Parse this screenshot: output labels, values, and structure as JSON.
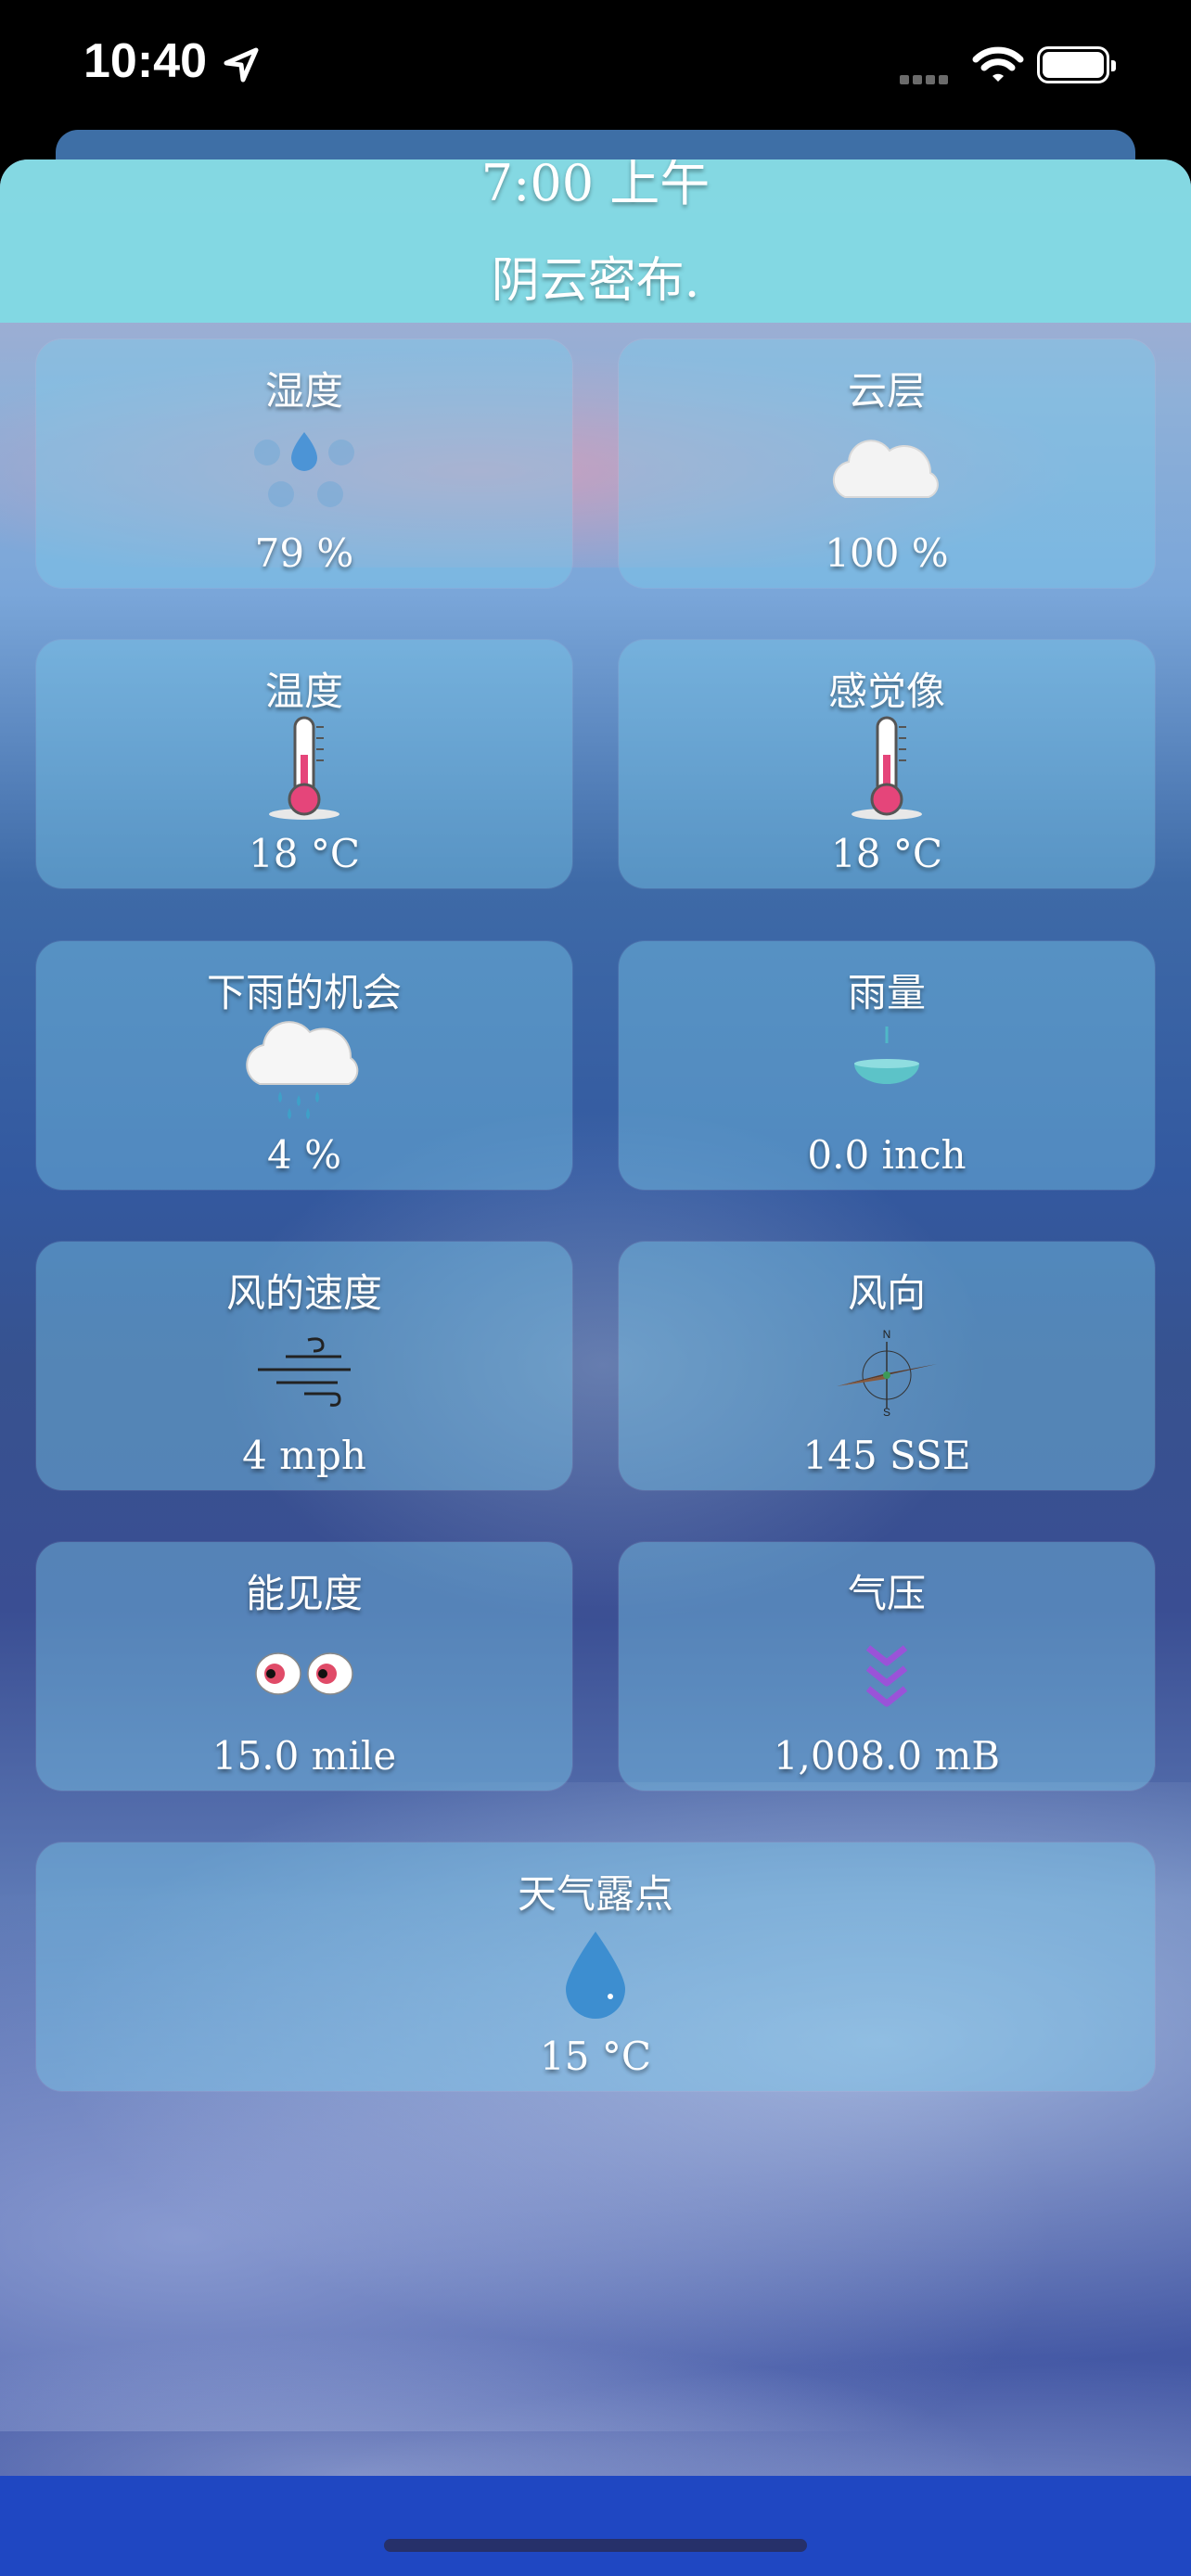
{
  "status_bar": {
    "time": "10:40"
  },
  "header": {
    "time": "7:00 上午",
    "description": "阴云密布."
  },
  "tiles": {
    "humidity": {
      "title": "湿度",
      "value": "79 %",
      "icon": "humidity-drops-icon"
    },
    "cloud": {
      "title": "云层",
      "value": "100 %",
      "icon": "cloud-icon"
    },
    "temperature": {
      "title": "温度",
      "value": "18 °C",
      "icon": "thermometer-icon"
    },
    "feels_like": {
      "title": "感觉像",
      "value": "18 °C",
      "icon": "thermometer-icon"
    },
    "rain_chance": {
      "title": "下雨的机会",
      "value": "4 %",
      "icon": "rain-cloud-icon"
    },
    "precipitation": {
      "title": "雨量",
      "value": "0.0 inch",
      "icon": "rain-gauge-icon"
    },
    "wind_speed": {
      "title": "风的速度",
      "value": "4 mph",
      "icon": "wind-icon"
    },
    "wind_direction": {
      "title": "风向",
      "value": "145 SSE",
      "icon": "compass-icon"
    },
    "visibility": {
      "title": "能见度",
      "value": "15.0 mile",
      "icon": "eyes-icon"
    },
    "pressure": {
      "title": "气压",
      "value": "1,008.0 mB",
      "icon": "pressure-down-icon"
    },
    "dew_point": {
      "title": "天气露点",
      "value": "15 °C",
      "icon": "water-drop-icon"
    }
  },
  "colors": {
    "header_bg": "#80dce4",
    "tile_bg": "#7dcdeb",
    "bottom_bar": "#1f47c2"
  }
}
